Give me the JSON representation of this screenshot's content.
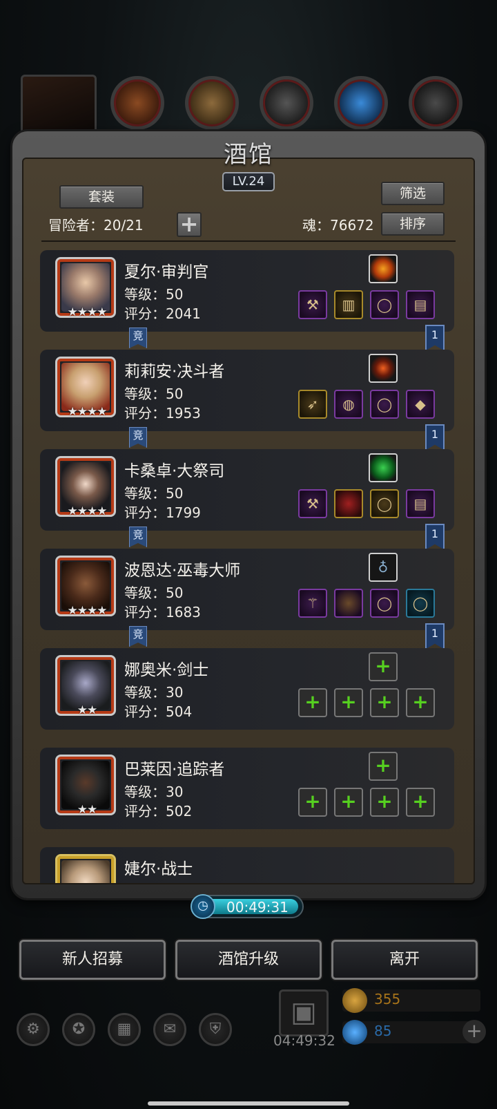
{
  "header": {
    "title": "酒馆",
    "level": "LV.24"
  },
  "top_icons": [
    "cape-icon",
    "chest-icon",
    "iron-icon",
    "crystal-icon",
    "anvil-icon"
  ],
  "toolbar": {
    "set_label": "套装",
    "filter_label": "筛选",
    "sort_label": "排序",
    "adventurers_label": "冒险者：20/21",
    "add_label": "+",
    "soul_label": "魂：76672"
  },
  "heroes": [
    {
      "name": "夏尔·审判官",
      "level": "等级：50",
      "score": "评分：2041",
      "stars": "★★★★",
      "comp": "竞",
      "rank": "1"
    },
    {
      "name": "莉莉安·决斗者",
      "level": "等级：50",
      "score": "评分：1953",
      "stars": "★★★★",
      "comp": "竞",
      "rank": "1"
    },
    {
      "name": "卡桑卓·大祭司",
      "level": "等级：50",
      "score": "评分：1799",
      "stars": "★★★★",
      "comp": "竞",
      "rank": "1"
    },
    {
      "name": "波恩达·巫毒大师",
      "level": "等级：50",
      "score": "评分：1683",
      "stars": "★★★★",
      "comp": "竞",
      "rank": "1"
    },
    {
      "name": "娜奥米·剑士",
      "level": "等级：30",
      "score": "评分：504",
      "stars": "★★"
    },
    {
      "name": "巴莱因·追踪者",
      "level": "等级：30",
      "score": "评分：502",
      "stars": "★★"
    },
    {
      "name": "婕尔·战士"
    }
  ],
  "timer": "00:49:31",
  "buttons": {
    "recruit": "新人招募",
    "upgrade": "酒馆升级",
    "leave": "离开"
  },
  "dock": {
    "gift_timer": "04:49:32",
    "gold": "355",
    "gems": "85"
  },
  "colors": {
    "accent_gold": "#c9a12a",
    "portrait_red": "#b63a16",
    "empty_slot_green": "#56d020",
    "timer_cyan": "#3ad0e0"
  }
}
